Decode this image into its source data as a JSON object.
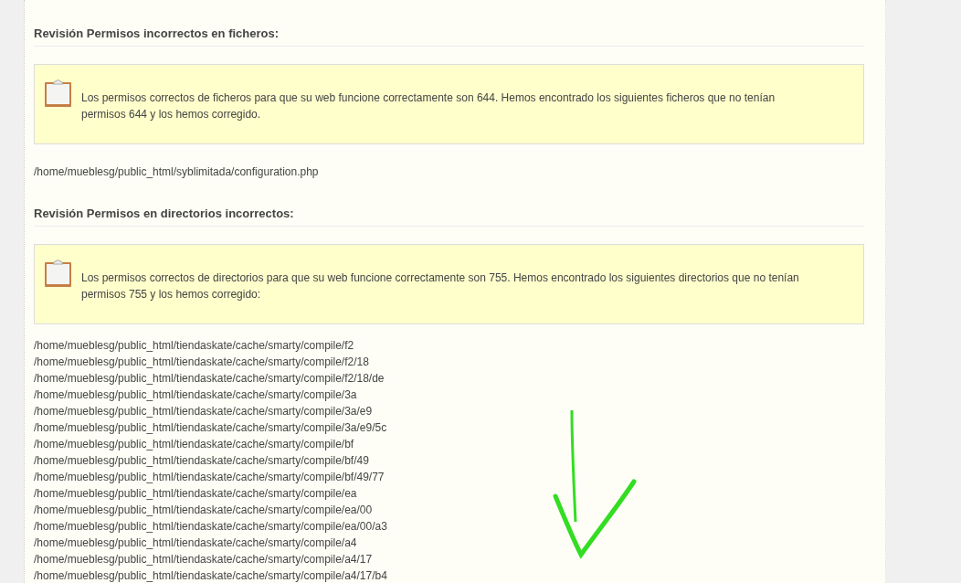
{
  "sections": [
    {
      "heading": "Revisión Permisos incorrectos en ficheros:",
      "notice": "Los permisos correctos de ficheros para que su web funcione correctamente son 644. Hemos encontrado los siguientes ficheros que no tenían permisos 644 y los hemos corregido.",
      "paths": [
        "/home/mueblesg/public_html/syblimitada/configuration.php"
      ]
    },
    {
      "heading": "Revisión Permisos en directorios incorrectos:",
      "notice": "Los permisos correctos de directorios para que su web funcione correctamente son 755. Hemos encontrado los siguientes directorios que no tenían permisos 755 y los hemos corregido:",
      "paths": [
        "/home/mueblesg/public_html/tiendaskate/cache/smarty/compile/f2",
        "/home/mueblesg/public_html/tiendaskate/cache/smarty/compile/f2/18",
        "/home/mueblesg/public_html/tiendaskate/cache/smarty/compile/f2/18/de",
        "/home/mueblesg/public_html/tiendaskate/cache/smarty/compile/3a",
        "/home/mueblesg/public_html/tiendaskate/cache/smarty/compile/3a/e9",
        "/home/mueblesg/public_html/tiendaskate/cache/smarty/compile/3a/e9/5c",
        "/home/mueblesg/public_html/tiendaskate/cache/smarty/compile/bf",
        "/home/mueblesg/public_html/tiendaskate/cache/smarty/compile/bf/49",
        "/home/mueblesg/public_html/tiendaskate/cache/smarty/compile/bf/49/77",
        "/home/mueblesg/public_html/tiendaskate/cache/smarty/compile/ea",
        "/home/mueblesg/public_html/tiendaskate/cache/smarty/compile/ea/00",
        "/home/mueblesg/public_html/tiendaskate/cache/smarty/compile/ea/00/a3",
        "/home/mueblesg/public_html/tiendaskate/cache/smarty/compile/a4",
        "/home/mueblesg/public_html/tiendaskate/cache/smarty/compile/a4/17",
        "/home/mueblesg/public_html/tiendaskate/cache/smarty/compile/a4/17/b4"
      ]
    }
  ]
}
